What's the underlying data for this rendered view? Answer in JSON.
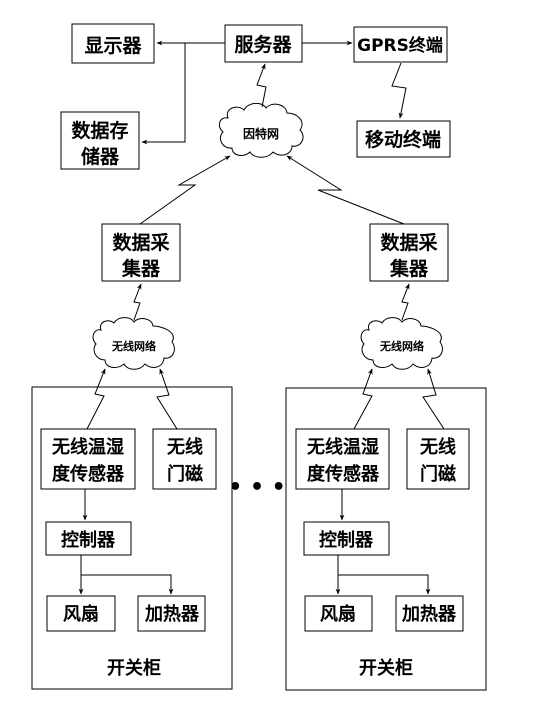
{
  "diagram": {
    "nodes": {
      "display": [
        "显示器"
      ],
      "server": [
        "服务器"
      ],
      "gprs_terminal": [
        "GPRS终端"
      ],
      "data_storage": [
        "数据存",
        "储器"
      ],
      "mobile_terminal": [
        "移动终端"
      ],
      "internet": "因特网",
      "collector_left": [
        "数据采",
        "集器"
      ],
      "collector_right": [
        "数据采",
        "集器"
      ],
      "wireless_net_left": "无线网络",
      "wireless_net_right": "无线网络"
    },
    "cabinets": [
      {
        "label": "开关柜",
        "sensor": [
          "无线温湿",
          "度传感器"
        ],
        "door": [
          "无线",
          "门磁"
        ],
        "controller": "控制器",
        "fan": "风扇",
        "heater": "加热器"
      },
      {
        "label": "开关柜",
        "sensor": [
          "无线温湿",
          "度传感器"
        ],
        "door": [
          "无线",
          "门磁"
        ],
        "controller": "控制器",
        "fan": "风扇",
        "heater": "加热器"
      }
    ],
    "ellipsis": "• • •",
    "edges": [
      {
        "from": "server",
        "to": "display",
        "type": "wired"
      },
      {
        "from": "server",
        "to": "data_storage",
        "type": "wired"
      },
      {
        "from": "server",
        "to": "gprs_terminal",
        "type": "wired"
      },
      {
        "from": "gprs_terminal",
        "to": "mobile_terminal",
        "type": "wireless"
      },
      {
        "from": "internet",
        "to": "server",
        "type": "wireless"
      },
      {
        "from": "collector_left",
        "to": "internet",
        "type": "wireless"
      },
      {
        "from": "collector_right",
        "to": "internet",
        "type": "wireless"
      },
      {
        "from": "wireless_net_left",
        "to": "collector_left",
        "type": "wireless"
      },
      {
        "from": "wireless_net_right",
        "to": "collector_right",
        "type": "wireless"
      },
      {
        "from": "sensor",
        "to": "wireless_net",
        "type": "wireless"
      },
      {
        "from": "door",
        "to": "wireless_net",
        "type": "wireless"
      },
      {
        "from": "sensor",
        "to": "controller",
        "type": "wired"
      },
      {
        "from": "controller",
        "to": "fan",
        "type": "wired"
      },
      {
        "from": "controller",
        "to": "heater",
        "type": "wired"
      }
    ]
  }
}
